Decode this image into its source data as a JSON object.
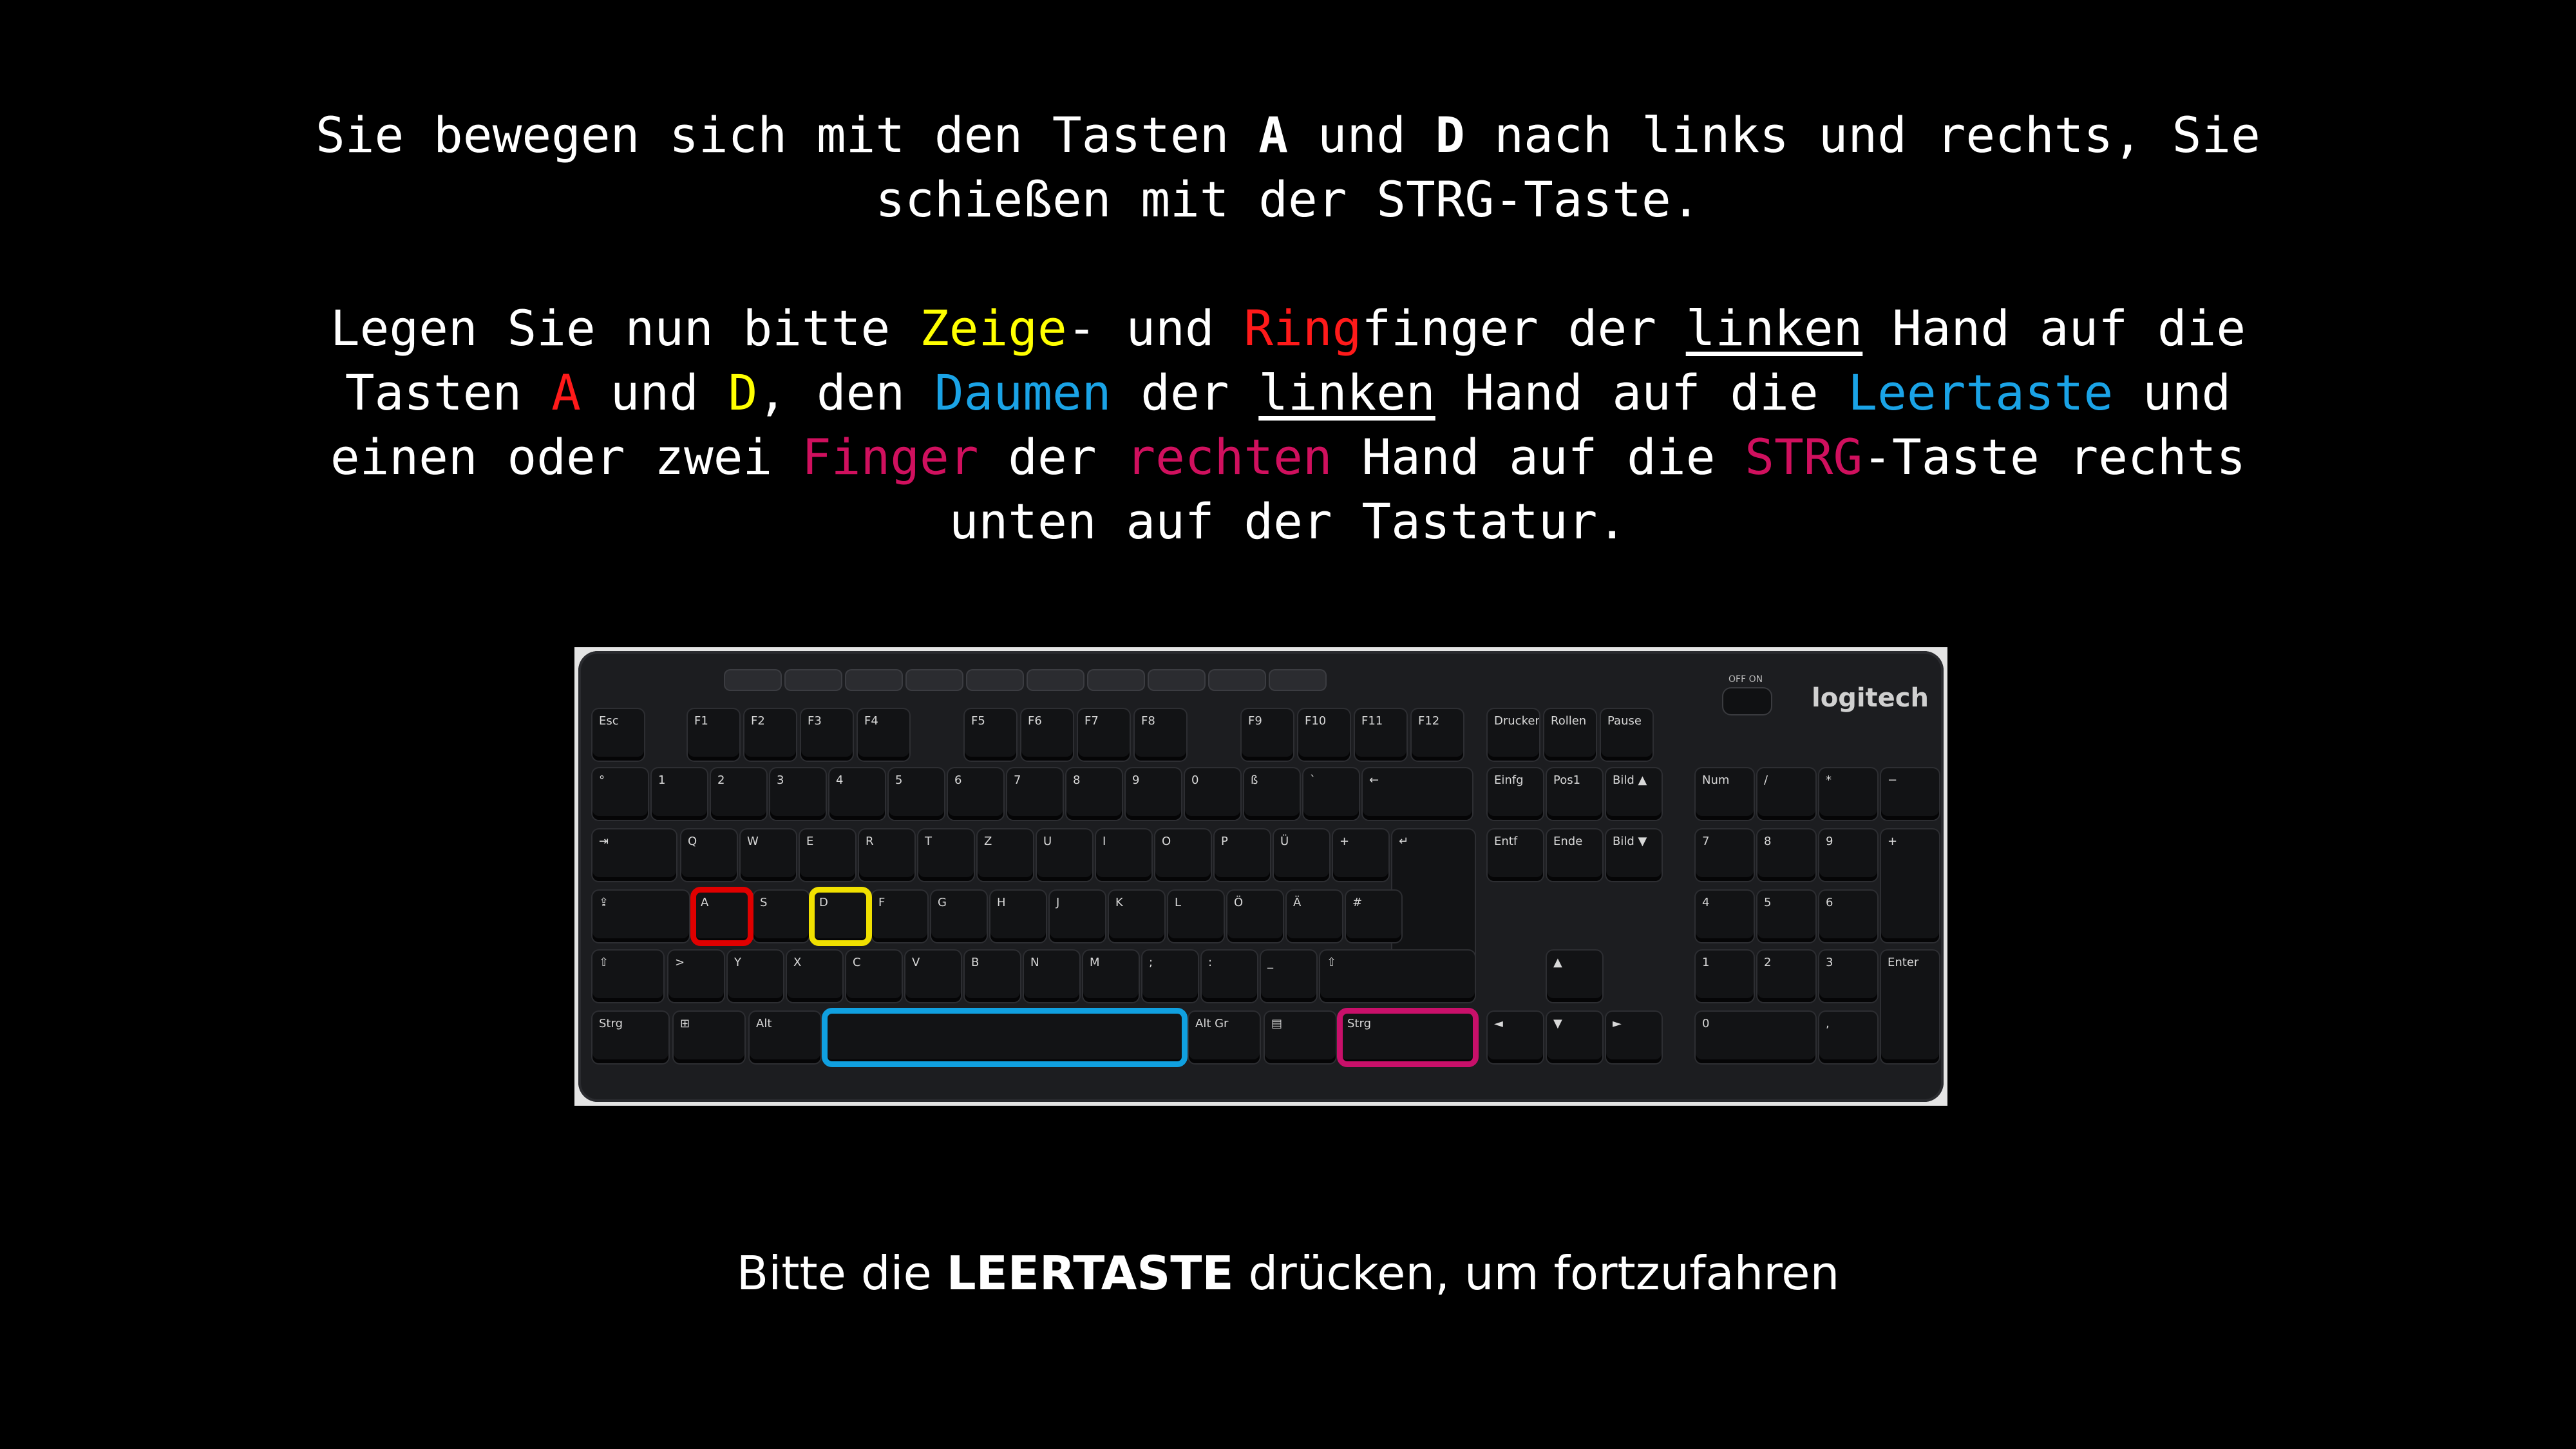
{
  "instructions": {
    "line1_part1": "Sie bewegen sich mit den Tasten ",
    "key_a": "A",
    "line1_part2": " und ",
    "key_d": "D",
    "line1_part3": " nach links und rechts, Sie schießen mit der STRG-Taste.",
    "p2_0": "Legen Sie nun bitte ",
    "p2_zeige": "Zeige",
    "p2_1": "- und ",
    "p2_ring": "Ring",
    "p2_2": "finger der ",
    "p2_linken1": "linken",
    "p2_3": " Hand auf die Tasten ",
    "p2_a": "A",
    "p2_4": " und ",
    "p2_d": "D",
    "p2_5": ", den ",
    "p2_daumen": "Daumen",
    "p2_6": " der ",
    "p2_linken2": "linken",
    "p2_7": " Hand auf die ",
    "p2_leertaste": "Leertaste",
    "p2_8": " und einen oder zwei ",
    "p2_finger": "Finger",
    "p2_9": " der ",
    "p2_rechten": "rechten",
    "p2_10": " Hand auf die ",
    "p2_strg": "STRG",
    "p2_11": "-Taste rechts unten auf der Tastatur."
  },
  "footer": {
    "part1": "Bitte die ",
    "leertaste": "LEERTASTE",
    "part2": " drücken, um fortzufahren"
  },
  "keyboard": {
    "brand": "logitech",
    "switch_label": "OFF  ON",
    "keys": {
      "esc": "Esc",
      "f1": "F1",
      "f2": "F2",
      "f3": "F3",
      "f4": "F4",
      "f5": "F5",
      "f6": "F6",
      "f7": "F7",
      "f8": "F8",
      "f9": "F9",
      "f10": "F10",
      "f11": "F11",
      "f12": "F12",
      "druck": "Drucken",
      "rollen": "Rollen",
      "pause": "Pause",
      "circ": "°",
      "n1": "1",
      "n2": "2",
      "n3": "3",
      "n4": "4",
      "n5": "5",
      "n6": "6",
      "n7": "7",
      "n8": "8",
      "n9": "9",
      "n0": "0",
      "sz": "ß",
      "acute": "`",
      "backspace": "←",
      "tab": "⇥",
      "q": "Q",
      "w": "W",
      "e": "E",
      "r": "R",
      "t": "T",
      "z": "Z",
      "u": "U",
      "i": "I",
      "o": "O",
      "p": "P",
      "ue": "Ü",
      "plus": "+",
      "enter": "↵",
      "caps": "⇪",
      "a": "A",
      "s": "S",
      "d": "D",
      "f": "F",
      "g": "G",
      "h": "H",
      "j": "J",
      "k": "K",
      "l": "L",
      "oe": "Ö",
      "ae": "Ä",
      "hash": "#",
      "lshift": "⇧",
      "lt": ">",
      "y": "Y",
      "x": "X",
      "c": "C",
      "v": "V",
      "b": "B",
      "n": "N",
      "m": "M",
      "comma": ";",
      "dot": ":",
      "minus": "_",
      "rshift": "⇧",
      "lctrl": "Strg",
      "win": "⊞",
      "alt": "Alt",
      "space": "",
      "altgr": "Alt Gr",
      "menu": "▤",
      "rctrl": "Strg",
      "einfg": "Einfg",
      "pos1": "Pos1",
      "bildup": "Bild ▲",
      "entf": "Entf",
      "ende": "Ende",
      "bilddown": "Bild ▼",
      "up": "▲",
      "left": "◄",
      "down": "▼",
      "right": "►",
      "num": "Num",
      "div": "/",
      "mul": "*",
      "sub": "−",
      "np7": "7",
      "np8": "8",
      "np9": "9",
      "add": "+",
      "np4": "4",
      "np5": "5",
      "np6": "6",
      "np1": "1",
      "np2": "2",
      "np3": "3",
      "npenter": "Enter",
      "np0": "0",
      "npdot": ","
    }
  },
  "colors": {
    "yellow": "#ffff00",
    "red": "#ff1a1a",
    "blue": "#1aa3e6",
    "magenta": "#d0105e",
    "white": "#ffffff",
    "highlight_a": "#e00000",
    "highlight_d": "#f0e000",
    "highlight_space": "#10a0e0",
    "highlight_strg": "#c8106a"
  }
}
